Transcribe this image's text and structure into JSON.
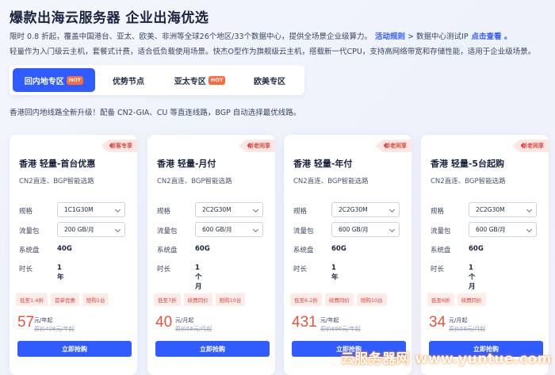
{
  "header": {
    "title": "爆款出海云服务器 企业出海优选",
    "desc_line1": "限时 0.8 折起，覆盖中国港台、亚太、欧美、非洲等全球26个地区/33个数据中心，提供全场景企业级算力。",
    "activity_link": "活动规则",
    "arrow": ">",
    "dc_test_text": "数据中心测试IP",
    "dc_test_link": "点击查看 。",
    "desc_line2": "轻量作为入门级云主机，套餐式计费，适合低负载使用场景。快杰O型作为旗舰级云主机，搭载新一代CPU，支持高网络带宽和存储性能，适用于企业级场景。"
  },
  "tabs": [
    {
      "label": "回内地专区",
      "badge": "HOT",
      "active": true
    },
    {
      "label": "优势节点",
      "badge": "",
      "active": false
    },
    {
      "label": "亚太专区",
      "badge": "HOT",
      "active": false
    },
    {
      "label": "欧美专区",
      "badge": "",
      "active": false
    }
  ],
  "notice": "香港回内地线路全新升级！配备 CN2-GIA、CU 等直连线路，BGP 自动选择最优线路。",
  "labels": {
    "spec": "规格",
    "traffic": "流量包",
    "disk": "系统盘",
    "duration": "时长",
    "buy": "立即抢购",
    "unit": "元/年起"
  },
  "cards": [
    {
      "ribbon": "新客专享",
      "title": "香港 轻量-首台优惠",
      "sub": "CN2直连、BGP智能选路",
      "spec": "1C1G30M",
      "traffic": "200 GB/月",
      "disk": "40G",
      "duration": "1年",
      "tags": [
        "低至1.4折",
        "首单优惠",
        "限购1台"
      ],
      "price": "57",
      "unit": "元/年起",
      "original": "原价408元/年起"
    },
    {
      "ribbon": "新老同享",
      "title": "香港 轻量-月付",
      "sub": "CN2直连、BGP智能选路",
      "spec": "2C2G30M",
      "traffic": "600 GB/月",
      "disk": "60G",
      "duration": "1个月",
      "tags": [
        "低至7折",
        "续费同价",
        "限购10台"
      ],
      "price": "40",
      "unit": "元/月起",
      "original": "原价58元/月起"
    },
    {
      "ribbon": "新老同享",
      "title": "香港 轻量-年付",
      "sub": "CN2直连、BGP智能选路",
      "spec": "2C2G30M",
      "traffic": "600 GB/月",
      "disk": "60G",
      "duration": "1年",
      "tags": [
        "低至6.2折",
        "续费同价",
        "限购10台"
      ],
      "price": "431",
      "unit": "元/年起",
      "original": "原价696元/年起"
    },
    {
      "ribbon": "新老同享",
      "title": "香港 轻量-5台起购",
      "sub": "CN2直连、BGP智能选路",
      "spec": "2C2G30M",
      "traffic": "600 GB/月",
      "disk": "60G",
      "duration": "1个月",
      "tags": [
        "低至6折",
        "续费同价"
      ],
      "price": "34",
      "unit": "元/月起",
      "original": "原价58元/月起"
    }
  ],
  "watermark": "云服务器网 www.yuntue.com",
  "colors": {
    "accent": "#2f5bff",
    "hot_badge": "#ff6a3d",
    "price": "#e6543a",
    "tag_bg": "#fdebe8"
  }
}
